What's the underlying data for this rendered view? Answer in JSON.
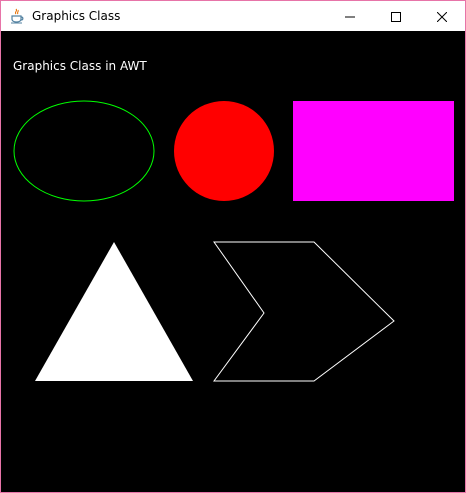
{
  "window": {
    "title": "Graphics Class",
    "icon": "java-icon",
    "controls": {
      "minimize_icon": "minimize-icon",
      "maximize_icon": "maximize-icon",
      "close_icon": "close-icon"
    },
    "border_color": "#e774a8"
  },
  "canvas": {
    "label": "Graphics Class in AWT",
    "background": "#000000",
    "shapes": {
      "oval": {
        "kind": "oval-outline",
        "color": "#00ff00"
      },
      "circle": {
        "kind": "circle-filled",
        "color": "#ff0000"
      },
      "rectangle": {
        "kind": "rectangle-filled",
        "color": "#ff00ff"
      },
      "triangle": {
        "kind": "triangle-filled",
        "color": "#ffffff"
      },
      "chevron": {
        "kind": "chevron-outline",
        "color": "#ffffff"
      }
    }
  }
}
